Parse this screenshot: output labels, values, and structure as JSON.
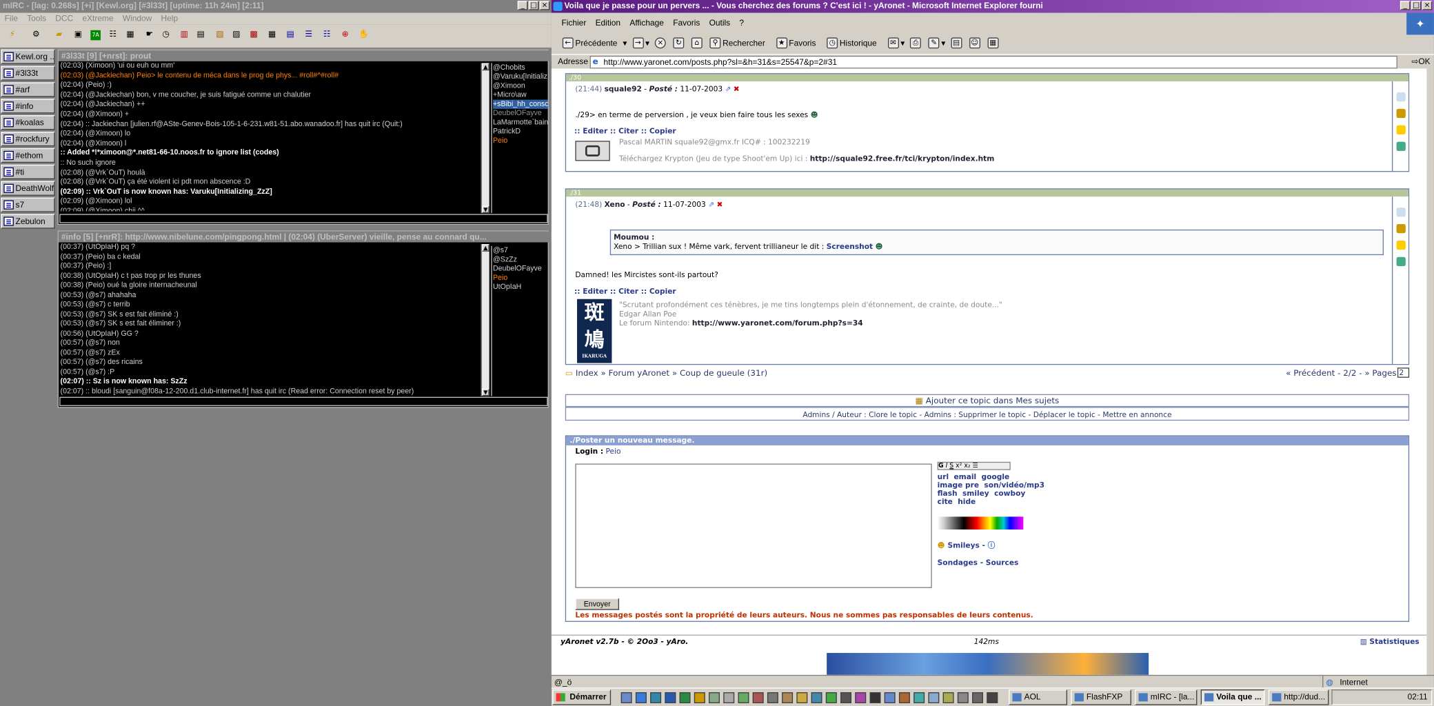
{
  "mirc": {
    "title": "mIRC - [lag: 0.268s] [+i] [Kewl.org] [#3l33t] [uptime: 11h 24m] [2:11]",
    "menu": [
      "File",
      "Tools",
      "DCC",
      "eXtreme",
      "Window",
      "Help"
    ],
    "switchbar": [
      "Kewl.org ...",
      "#3l33t",
      "#arf",
      "#info",
      "#koalas",
      "#rockfury",
      "#ethom",
      "#ti",
      "DeathWolf",
      "s7",
      "Zebulon"
    ],
    "win1": {
      "title": "#3l33t [9] [+nrst]: prout",
      "lines": [
        {
          "t": "(02:03) (Ximoon) 'ui ou euh ou mm'",
          "c": ""
        },
        {
          "t": "(02:03) (@Jackiechan) Peio> le contenu de méca dans le prog de phys... #roll#^#roll#",
          "c": "o"
        },
        {
          "t": "(02:04) (Peio) :)",
          "c": ""
        },
        {
          "t": "(02:04) (@Jackiechan) bon, v me coucher, je suis fatigué comme un chalutier",
          "c": ""
        },
        {
          "t": "(02:04) (@Jackiechan) ++",
          "c": ""
        },
        {
          "t": "(02:04) (@Ximoon) +",
          "c": ""
        },
        {
          "t": "(02:04) :: Jackiechan [julien.rf@ASte-Genev-Bois-105-1-6-231.w81-51.abo.wanadoo.fr] has quit irc (Quit:)",
          "c": ""
        },
        {
          "t": "(02:04) (@Ximoon) lo",
          "c": ""
        },
        {
          "t": "(02:04) (@Ximoon) l",
          "c": ""
        },
        {
          "t": ":: Added *!*ximoon@*.net81-66-10.noos.fr to ignore list (codes)",
          "c": "w b"
        },
        {
          "t": ":: No such ignore",
          "c": ""
        },
        {
          "t": "(02:08) (@Vrk`OuT) houlà",
          "c": ""
        },
        {
          "t": "(02:08) (@Vrk`OuT) ça été violent ici pdt mon abscence :D",
          "c": ""
        },
        {
          "t": "(02:09) :: Vrk`OuT is now known has: Varuku[Initializing_ZzZ]",
          "c": "w b"
        },
        {
          "t": "(02:09) (@Ximoon) lol",
          "c": ""
        },
        {
          "t": "(02:09) (@Ximoon) chii ^^",
          "c": ""
        }
      ],
      "nicks": [
        {
          "n": "@Chobits",
          "c": ""
        },
        {
          "n": "@Varuku[Initializi",
          "c": ""
        },
        {
          "n": "@Ximoon",
          "c": ""
        },
        {
          "n": "+Micro\\aw",
          "c": ""
        },
        {
          "n": "+sBibi_hh_consc",
          "c": "sel"
        },
        {
          "n": "DeubelOFayve",
          "c": "g"
        },
        {
          "n": "LaMarmotte`bain",
          "c": ""
        },
        {
          "n": "PatrickD",
          "c": ""
        },
        {
          "n": "Peio",
          "c": "o"
        }
      ]
    },
    "win2": {
      "title": "#info [5] [+nrR]: http://www.nibelune.com/pingpong.html | (02:04) (UberServer) vieille, pense au connard qu...",
      "lines": [
        {
          "t": "(00:37) (UtOpIaH) pq ?",
          "c": ""
        },
        {
          "t": "(00:37) (Peio) ba c kedal",
          "c": ""
        },
        {
          "t": "(00:37) (Peio) :]",
          "c": ""
        },
        {
          "t": "(00:38) (UtOpIaH) c t pas trop pr les thunes",
          "c": ""
        },
        {
          "t": "(00:38) (Peio) oué la gloire internacheunal",
          "c": ""
        },
        {
          "t": "(00:53) (@s7) ahahaha",
          "c": ""
        },
        {
          "t": "(00:53) (@s7) c terrib",
          "c": ""
        },
        {
          "t": "(00:53) (@s7) SK s est fait éliminé :)",
          "c": ""
        },
        {
          "t": "(00:53) (@s7) SK s est fait éliminer :)",
          "c": ""
        },
        {
          "t": "(00:56) (UtOpIaH) GG ?",
          "c": ""
        },
        {
          "t": "(00:57) (@s7) non",
          "c": ""
        },
        {
          "t": "(00:57) (@s7) zEx",
          "c": ""
        },
        {
          "t": "(00:57) (@s7) des ricains",
          "c": ""
        },
        {
          "t": "(00:57) (@s7) :P",
          "c": ""
        },
        {
          "t": "(02:07) :: Sz is now known has: SzZz",
          "c": "w b"
        },
        {
          "t": "(02:07) :: bloudi [sanguin@f08a-12-200.d1.club-internet.fr] has quit irc (Read error: Connection reset by peer)",
          "c": ""
        }
      ],
      "nicks": [
        {
          "n": "@s7",
          "c": ""
        },
        {
          "n": "@SzZz",
          "c": ""
        },
        {
          "n": "DeubelOFayve",
          "c": ""
        },
        {
          "n": "Peio",
          "c": "o"
        },
        {
          "n": "UtOpIaH",
          "c": ""
        }
      ]
    }
  },
  "ie": {
    "title": "Voila que je passe pour un pervers ... - Vous cherchez des forums ? C'est ici ! - yAronet - Microsoft Internet Explorer fourni",
    "menu": [
      "Fichier",
      "Edition",
      "Affichage",
      "Favoris",
      "Outils",
      "?"
    ],
    "tool": {
      "back": "Précédente",
      "search": "Rechercher",
      "fav": "Favoris",
      "hist": "Historique"
    },
    "addr_label": "Adresse",
    "url": "http://www.yaronet.com/posts.php?sl=&h=31&s=25547&p=2#31",
    "go": "OK",
    "post30": {
      "num": "./30",
      "time": "(21:44)",
      "user": "squale92",
      "posted": "Posté :",
      "date": "11-07-2003",
      "body": "./29> en terme de perversion , je veux bien faire tous les sexes",
      "actions": ":: Editer  :: Citer  :: Copier",
      "sig1": "Pascal MARTIN squale92@gmx.fr ICQ# : 100232219",
      "sig2": "Téléchargez Krypton (Jeu de type Shoot'em Up) ici :",
      "sig2link": "http://squale92.free.fr/tci/krypton/index.htm"
    },
    "post31": {
      "num": "./31",
      "time": "(21:48)",
      "user": "Xeno",
      "posted": "Posté :",
      "date": "11-07-2003",
      "quote_author": "Moumou :",
      "quote": "Xeno > Trillian sux ! Même vark, fervent trillianeur le dit :",
      "quote_link": "Screenshot",
      "body": "Damned! les Mircistes sont-ils partout?",
      "actions": ":: Editer  :: Citer  :: Copier",
      "sig1": "\"Scrutant profondément ces ténèbres, je me tins longtemps plein d'étonnement, de crainte, de doute...\"",
      "sig2": "Edgar Allan Poe",
      "sig3": "Le forum Nintendo:",
      "sig3link": "http://www.yaronet.com/forum.php?s=34",
      "avatar_text": "IKARUGA"
    },
    "crumbs": {
      "path": "Index » Forum yAronet » Coup de gueule (31r)",
      "pager": "« Précédent - 2/2 - »  Pages",
      "page": "2"
    },
    "topic_add": "Ajouter ce topic dans Mes sujets",
    "admin_bar": "Admins / Auteur : Clore le topic - Admins : Supprimer le topic - Déplacer le topic - Mettre en annonce",
    "compose": {
      "header": "./Poster un nouveau message.",
      "login": "Login :",
      "login_user": "Peio",
      "tags": "url  email  google\nimage pre  son/vidéo/mp3\nflash  smiley  cowboy\ncite  hide",
      "smileys": "Smileys -",
      "links": "Sondages - Sources",
      "send": "Envoyer",
      "disclaimer": "Les messages postés sont la propriété de leurs auteurs. Nous ne sommes pas responsables de leurs contenus."
    },
    "footer": {
      "version": "yAronet v2.7b - © 2Oo3 - yAro.",
      "timing": "142ms",
      "stats": "Statistiques"
    },
    "status": "@_ö",
    "zone": "Internet"
  },
  "taskbar": {
    "start": "Démarrer",
    "tasks": [
      "AOL",
      "FlashFXP",
      "mIRC - [la...",
      "Voila que ...",
      "http://dud..."
    ],
    "clock": "02:11"
  }
}
